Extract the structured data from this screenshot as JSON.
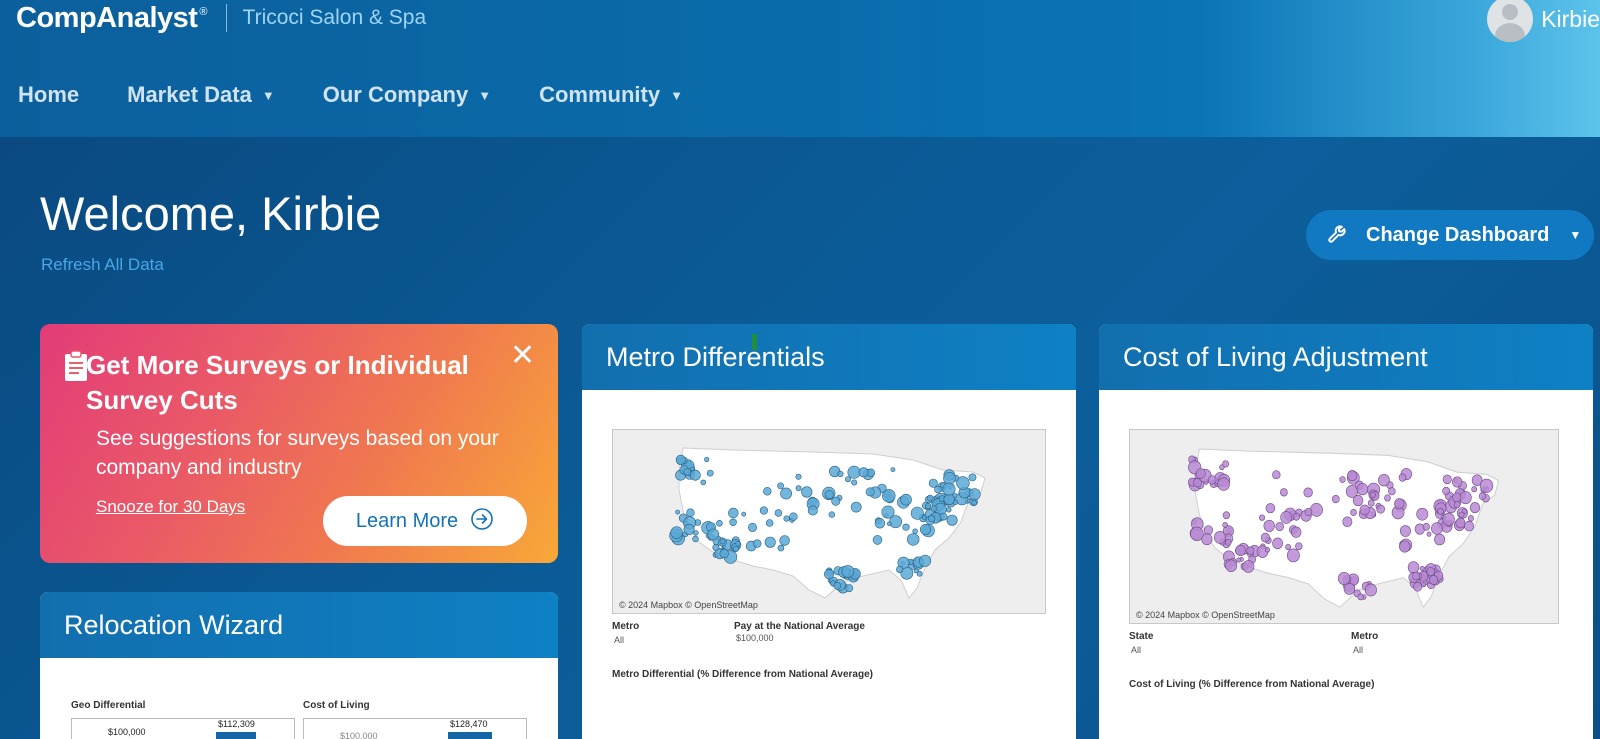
{
  "header": {
    "brand": "CompAnalyst",
    "brand_mark": "®",
    "company": "Tricoci Salon & Spa",
    "user_name": "Kirbie",
    "nav": [
      {
        "label": "Home",
        "has_caret": false
      },
      {
        "label": "Market Data",
        "has_caret": true
      },
      {
        "label": "Our Company",
        "has_caret": true
      },
      {
        "label": "Community",
        "has_caret": true
      }
    ],
    "caret_glyph": "▼"
  },
  "welcome": {
    "title": "Welcome, Kirbie",
    "refresh_label": "Refresh All Data"
  },
  "change_dashboard": {
    "label": "Change Dashboard",
    "icon": "wrench-icon",
    "caret": "▼"
  },
  "promo": {
    "title": "Get More Surveys or Individual Survey Cuts",
    "description": "See suggestions for surveys based on your company and industry",
    "snooze_label": "Snooze for 30 Days",
    "learn_more_label": "Learn More",
    "close_glyph": "✕",
    "icon": "clipboard-icon"
  },
  "metro_card": {
    "title": "Metro Differentials",
    "map_credit": "© 2024 Mapbox © OpenStreetMap",
    "filter1_label": "Metro",
    "filter1_value": "All",
    "filter2_label": "Pay at the National Average",
    "filter2_value": "$100,000",
    "chart_title": "Metro Differential (% Difference from National Average)",
    "dot_color": "#5aa9d6"
  },
  "col_card": {
    "title": "Cost of Living Adjustment",
    "map_credit": "© 2024 Mapbox © OpenStreetMap",
    "filter1_label": "State",
    "filter1_value": "All",
    "filter2_label": "Metro",
    "filter2_value": "All",
    "chart_title": "Cost of Living (% Difference from National Average)",
    "dot_color": "#b98ad4"
  },
  "reloc_card": {
    "title": "Relocation Wizard",
    "geo_label": "Geo Differential",
    "geo_base": "$100,000",
    "geo_value": "$112,309",
    "col_label": "Cost of Living",
    "col_base": "$100,000",
    "col_value": "$128,470"
  }
}
